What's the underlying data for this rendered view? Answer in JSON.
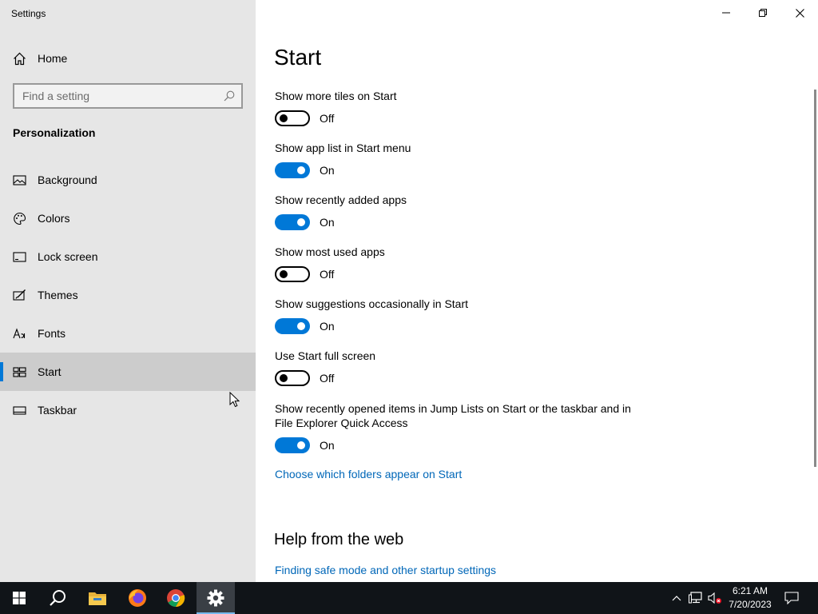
{
  "app": {
    "title": "Settings"
  },
  "sidebar": {
    "home_label": "Home",
    "search_placeholder": "Find a setting",
    "section": "Personalization",
    "items": [
      {
        "label": "Background",
        "icon": "image-icon"
      },
      {
        "label": "Colors",
        "icon": "palette-icon"
      },
      {
        "label": "Lock screen",
        "icon": "lock-screen-icon"
      },
      {
        "label": "Themes",
        "icon": "themes-icon"
      },
      {
        "label": "Fonts",
        "icon": "fonts-icon"
      },
      {
        "label": "Start",
        "icon": "start-icon",
        "active": true
      },
      {
        "label": "Taskbar",
        "icon": "taskbar-icon"
      }
    ]
  },
  "main": {
    "title": "Start",
    "settings": [
      {
        "label": "Show more tiles on Start",
        "state": "Off",
        "on": false
      },
      {
        "label": "Show app list in Start menu",
        "state": "On",
        "on": true
      },
      {
        "label": "Show recently added apps",
        "state": "On",
        "on": true
      },
      {
        "label": "Show most used apps",
        "state": "Off",
        "on": false
      },
      {
        "label": "Show suggestions occasionally in Start",
        "state": "On",
        "on": true
      },
      {
        "label": "Use Start full screen",
        "state": "Off",
        "on": false
      },
      {
        "label": "Show recently opened items in Jump Lists on Start or the taskbar and in File Explorer Quick Access",
        "state": "On",
        "on": true
      }
    ],
    "folders_link": "Choose which folders appear on Start",
    "help_title": "Help from the web",
    "help_link": "Finding safe mode and other startup settings"
  },
  "taskbar": {
    "time": "6:21 AM",
    "date": "7/20/2023",
    "apps": [
      "start-icon",
      "search-icon",
      "file-explorer-icon",
      "firefox-icon",
      "chrome-icon",
      "settings-icon"
    ]
  },
  "colors": {
    "accent": "#0078d7",
    "link": "#0067b8",
    "sidebar_bg": "#e6e6e6",
    "taskbar_bg": "#101418"
  }
}
